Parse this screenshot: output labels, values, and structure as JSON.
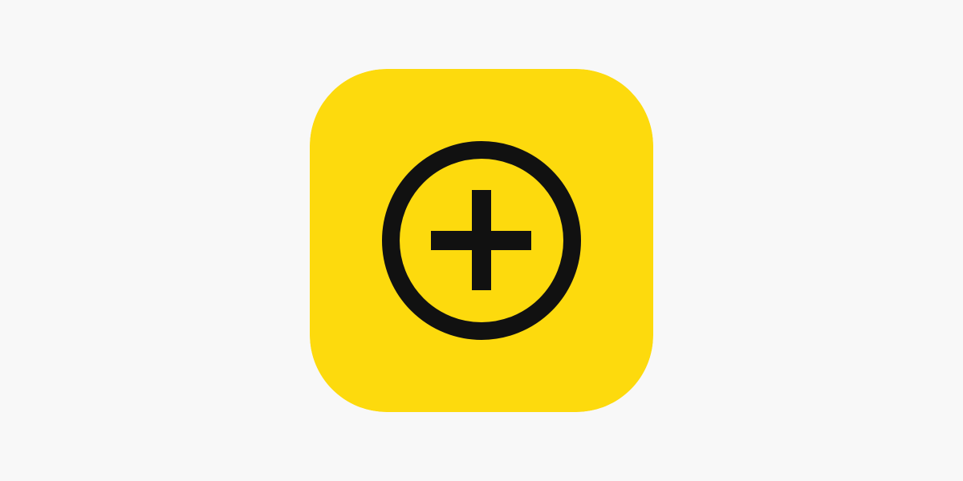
{
  "page": {
    "background_color": "#f8f8f8"
  },
  "app_icon": {
    "icon_name": "plus-in-circle-icon",
    "background_color": "#fdda0d",
    "glyph_color": "#111111"
  }
}
